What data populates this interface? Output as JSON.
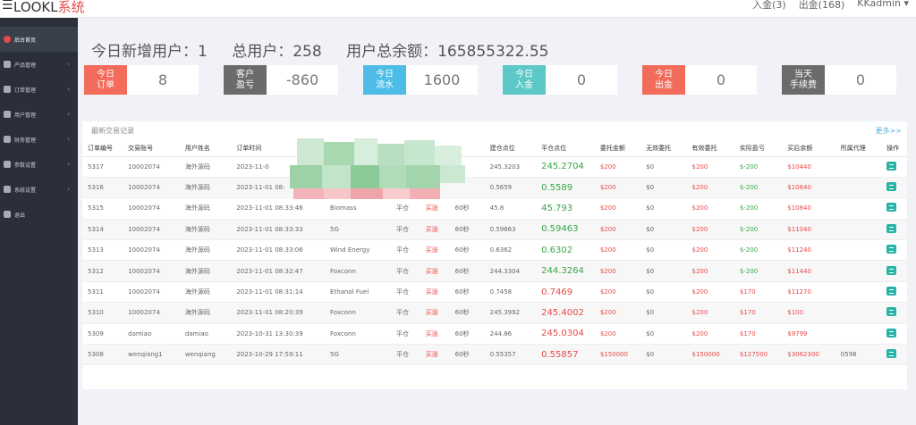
{
  "topbar": {
    "menu_icon": "hamburger-icon",
    "brand_main": "LOOKL",
    "brand_accent": "系统",
    "links": [
      "入金(3)",
      "出金(168)",
      "KKadmin ▾"
    ]
  },
  "sidebar": {
    "items": [
      {
        "label": "后台首页",
        "icon": "home-icon"
      },
      {
        "label": "产品管理",
        "icon": "box-icon"
      },
      {
        "label": "订单管理",
        "icon": "order-icon"
      },
      {
        "label": "用户管理",
        "icon": "user-icon"
      },
      {
        "label": "财务管理",
        "icon": "finance-icon"
      },
      {
        "label": "参数设置",
        "icon": "settings-icon"
      },
      {
        "label": "系统设置",
        "icon": "gear-icon"
      },
      {
        "label": "退出",
        "icon": "logout-icon"
      }
    ]
  },
  "headline": {
    "new_users": "今日新增用户：1",
    "total_users": "总用户：258",
    "total_balance": "用户总余额：165855322.55"
  },
  "stats": [
    {
      "label1": "今日",
      "label2": "订单",
      "value": "8",
      "color": "#f26b5b"
    },
    {
      "label1": "客户",
      "label2": "盈亏",
      "value": "-860",
      "color": "#6b6b6b"
    },
    {
      "label1": "今日",
      "label2": "流水",
      "value": "1600",
      "color": "#4dbde8"
    },
    {
      "label1": "今日",
      "label2": "入金",
      "value": "0",
      "color": "#5dc8c8"
    },
    {
      "label1": "今日",
      "label2": "出金",
      "value": "0",
      "color": "#f26b5b"
    },
    {
      "label1": "当天",
      "label2": "手续费",
      "value": "0",
      "color": "#6b6b6b"
    }
  ],
  "table": {
    "title": "最新交易记录",
    "more": "更多>>",
    "headers": [
      "订单编号",
      "交易账号",
      "用户姓名",
      "订单时间",
      "",
      "",
      "",
      "",
      "建仓点位",
      "平仓点位",
      "委托金额",
      "无效委托",
      "有效委托",
      "实际盈亏",
      "买后余额",
      "所属代理",
      "操作"
    ],
    "rows": [
      {
        "id": "5317",
        "acct": "10002074",
        "name": "海外源码",
        "time": "2023-11-0",
        "product": "",
        "type": "",
        "dir": "",
        "period": "",
        "open": "245.3203",
        "close": "245.2704",
        "close_dir": "up",
        "amount": "$200",
        "invalid": "$0",
        "valid": "$200",
        "pnl": "$-200",
        "balance": "$10440",
        "agent": ""
      },
      {
        "id": "5316",
        "acct": "10002074",
        "name": "海外源码",
        "time": "2023-11-01 08:",
        "product": "",
        "type": "",
        "dir": "",
        "period": "",
        "open": "0.5659",
        "close": "0.5589",
        "close_dir": "up",
        "amount": "$200",
        "invalid": "$0",
        "valid": "$200",
        "pnl": "$-200",
        "balance": "$10640",
        "agent": ""
      },
      {
        "id": "5315",
        "acct": "10002074",
        "name": "海外源码",
        "time": "2023-11-01 08:33:46",
        "product": "Biomass",
        "type": "平仓",
        "dir": "买涨",
        "period": "60秒",
        "open": "45.8",
        "close": "45.793",
        "close_dir": "up",
        "amount": "$200",
        "invalid": "$0",
        "valid": "$200",
        "pnl": "$-200",
        "balance": "$10840",
        "agent": ""
      },
      {
        "id": "5314",
        "acct": "10002074",
        "name": "海外源码",
        "time": "2023-11-01 08:33:33",
        "product": "5G",
        "type": "平仓",
        "dir": "买涨",
        "period": "60秒",
        "open": "0.59663",
        "close": "0.59463",
        "close_dir": "up",
        "amount": "$200",
        "invalid": "$0",
        "valid": "$200",
        "pnl": "$-200",
        "balance": "$11040",
        "agent": ""
      },
      {
        "id": "5313",
        "acct": "10002074",
        "name": "海外源码",
        "time": "2023-11-01 08:33:06",
        "product": "Wind Energy",
        "type": "平仓",
        "dir": "买涨",
        "period": "60秒",
        "open": "0.6362",
        "close": "0.6302",
        "close_dir": "up",
        "amount": "$200",
        "invalid": "$0",
        "valid": "$200",
        "pnl": "$-200",
        "balance": "$11240",
        "agent": ""
      },
      {
        "id": "5312",
        "acct": "10002074",
        "name": "海外源码",
        "time": "2023-11-01 08:32:47",
        "product": "Foxconn",
        "type": "平仓",
        "dir": "买涨",
        "period": "60秒",
        "open": "244.3304",
        "close": "244.3264",
        "close_dir": "up",
        "amount": "$200",
        "invalid": "$0",
        "valid": "$200",
        "pnl": "$-200",
        "balance": "$11440",
        "agent": ""
      },
      {
        "id": "5311",
        "acct": "10002074",
        "name": "海外源码",
        "time": "2023-11-01 08:31:14",
        "product": "Ethanol Fuel",
        "type": "平仓",
        "dir": "买涨",
        "period": "60秒",
        "open": "0.7458",
        "close": "0.7469",
        "close_dir": "down",
        "amount": "$200",
        "invalid": "$0",
        "valid": "$200",
        "pnl": "$170",
        "balance": "$11270",
        "agent": ""
      },
      {
        "id": "5310",
        "acct": "10002074",
        "name": "海外源码",
        "time": "2023-11-01 08:20:39",
        "product": "Foxconn",
        "type": "平仓",
        "dir": "买涨",
        "period": "60秒",
        "open": "245.3992",
        "close": "245.4002",
        "close_dir": "down",
        "amount": "$200",
        "invalid": "$0",
        "valid": "$200",
        "pnl": "$170",
        "balance": "$100",
        "agent": ""
      },
      {
        "id": "5309",
        "acct": "damiao",
        "name": "damiao",
        "time": "2023-10-31 13:30:39",
        "product": "Foxconn",
        "type": "平仓",
        "dir": "买涨",
        "period": "60秒",
        "open": "244.86",
        "close": "245.0304",
        "close_dir": "down",
        "amount": "$200",
        "invalid": "$0",
        "valid": "$200",
        "pnl": "$170",
        "balance": "$9799",
        "agent": ""
      },
      {
        "id": "5308",
        "acct": "wenqiang1",
        "name": "wenqiang",
        "time": "2023-10-29 17:59:11",
        "product": "5G",
        "type": "平仓",
        "dir": "买涨",
        "period": "60秒",
        "open": "0.55357",
        "close": "0.55857",
        "close_dir": "down",
        "amount": "$150000",
        "invalid": "$0",
        "valid": "$150000",
        "pnl": "$127500",
        "balance": "$3062300",
        "agent": "0598"
      }
    ]
  }
}
